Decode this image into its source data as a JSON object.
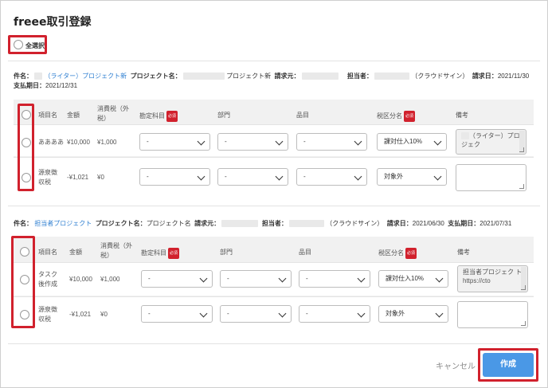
{
  "dialog": {
    "title": "freee取引登録",
    "select_all_label": "全選択",
    "cancel_label": "キャンセル",
    "create_label": "作成"
  },
  "accent": {
    "highlight": "#d1212d",
    "primary_button": "#4a98e6",
    "link": "#2f7fd1",
    "required_badge": "#d1212d"
  },
  "columns": {
    "item": "項目名",
    "amount": "金額",
    "tax": "消費税（外税）",
    "account": "勘定科目",
    "dept": "部門",
    "product": "品目",
    "tax_class": "税区分名",
    "note": "備考",
    "required_badge": "必須"
  },
  "groups": [
    {
      "info": {
        "subject_label": "件名：",
        "subject_value": "（ライター）プロジェクト新",
        "project_label": "プロジェクト名：",
        "project_value": "プロジェクト新",
        "client_label": "請求元：",
        "owner_label": "担当者：",
        "owner_value": "（クラウドサイン）",
        "billing_label": "請求日：",
        "billing_date": "2021/11/30",
        "payment_label": "支払期日：",
        "payment_date": "2021/12/31"
      },
      "rows": [
        {
          "item": "ああああ",
          "amount": "¥10,000",
          "tax": "¥1,000",
          "account": "-",
          "dept": "-",
          "product": "-",
          "tax_class": "課対仕入10%",
          "note": "（ライター）プロジェク"
        },
        {
          "item": "源泉徴収税",
          "amount": "-¥1,021",
          "tax": "¥0",
          "account": "-",
          "dept": "-",
          "product": "-",
          "tax_class": "対象外",
          "note": ""
        }
      ]
    },
    {
      "info": {
        "subject_label": "件名：",
        "subject_value": "担当者プロジェクト",
        "project_label": "プロジェクト名：",
        "project_value": "プロジェクト名",
        "client_label": "請求元：",
        "owner_label": "担当者：",
        "owner_value": "（クラウドサイン）",
        "billing_label": "請求日：",
        "billing_date": "2021/06/30",
        "payment_label": "支払期日：",
        "payment_date": "2021/07/31"
      },
      "rows": [
        {
          "item": "タスク後作成",
          "amount": "¥10,000",
          "tax": "¥1,000",
          "account": "-",
          "dept": "-",
          "product": "-",
          "tax_class": "課対仕入10%",
          "note": "担当者プロジェク ト https://cto"
        },
        {
          "item": "源泉徴収税",
          "amount": "-¥1,021",
          "tax": "¥0",
          "account": "-",
          "dept": "-",
          "product": "-",
          "tax_class": "対象外",
          "note": ""
        }
      ]
    }
  ]
}
